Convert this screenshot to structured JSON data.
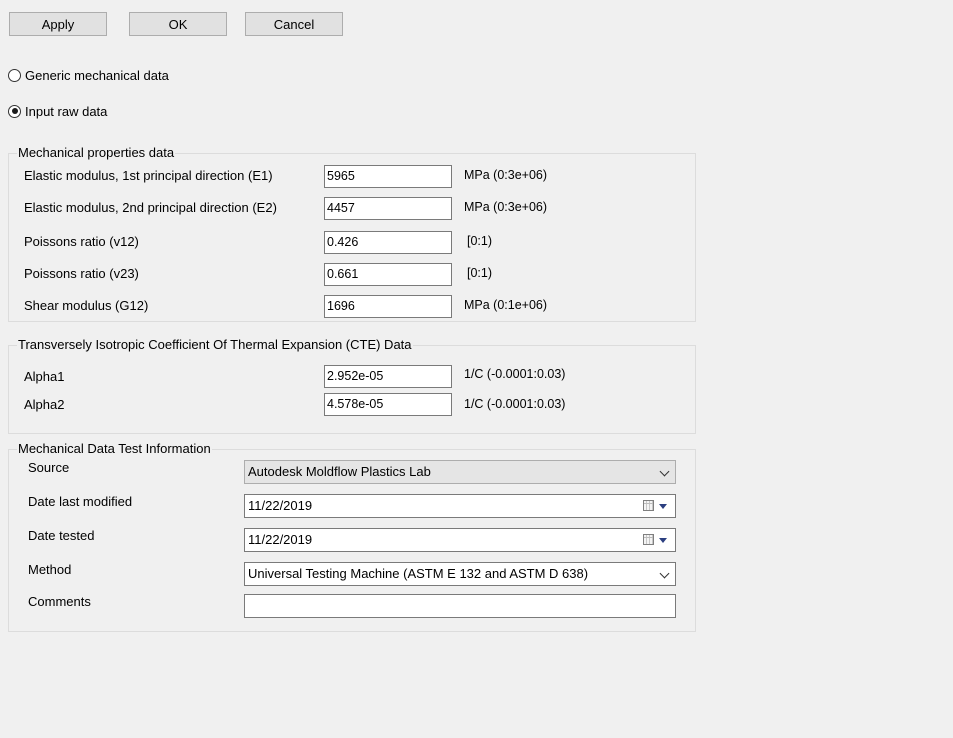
{
  "buttons": {
    "apply": "Apply",
    "ok": "OK",
    "cancel": "Cancel"
  },
  "options": {
    "generic": {
      "label": "Generic mechanical data",
      "checked": false
    },
    "raw": {
      "label": "Input raw data",
      "checked": true
    }
  },
  "mechanical": {
    "title": "Mechanical properties data",
    "rows": [
      {
        "label": "Elastic modulus, 1st principal direction (E1)",
        "value": "5965",
        "unit": "MPa (0:3e+06)"
      },
      {
        "label": "Elastic modulus, 2nd principal direction (E2)",
        "value": "4457",
        "unit": "MPa (0:3e+06)"
      },
      {
        "label": "Poissons ratio (v12)",
        "value": "0.426",
        "unit": "[0:1)"
      },
      {
        "label": "Poissons ratio (v23)",
        "value": "0.661",
        "unit": "[0:1)"
      },
      {
        "label": "Shear modulus (G12)",
        "value": "1696",
        "unit": "MPa (0:1e+06)"
      }
    ]
  },
  "cte": {
    "title": "Transversely Isotropic Coefficient Of Thermal Expansion (CTE) Data",
    "rows": [
      {
        "label": "Alpha1",
        "value": "2.952e-05",
        "unit": "1/C (-0.0001:0.03)"
      },
      {
        "label": "Alpha2",
        "value": "4.578e-05",
        "unit": "1/C (-0.0001:0.03)"
      }
    ]
  },
  "test_info": {
    "title": "Mechanical Data Test Information",
    "source": {
      "label": "Source",
      "value": "Autodesk Moldflow Plastics Lab"
    },
    "date_modified": {
      "label": "Date last modified",
      "value": "11/22/2019"
    },
    "date_tested": {
      "label": "Date tested",
      "value": "11/22/2019"
    },
    "method": {
      "label": "Method",
      "value": "Universal Testing Machine (ASTM E 132 and ASTM D 638)"
    },
    "comments": {
      "label": "Comments",
      "value": ""
    }
  }
}
